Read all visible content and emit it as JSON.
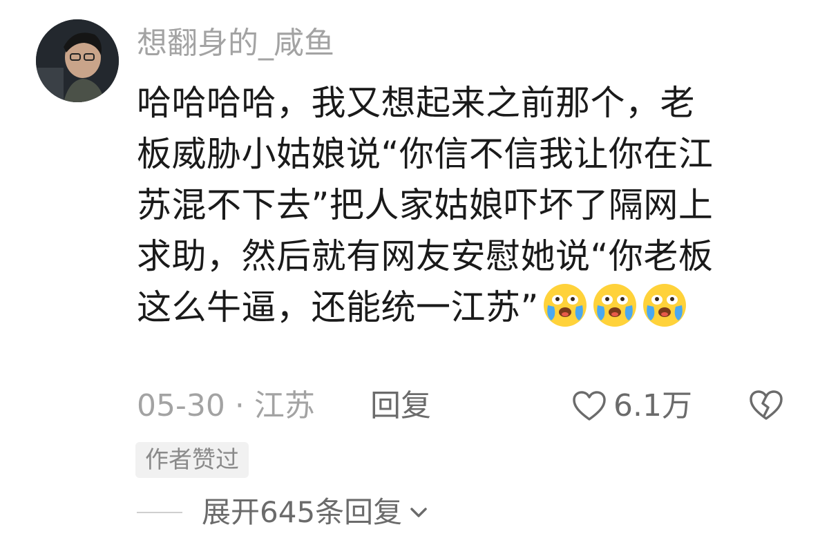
{
  "comment": {
    "username": "想翻身的_咸鱼",
    "content_lines": [
      "哈哈哈哈，我又想起来之前那个，老",
      "板威胁小姑娘说“你信不信我让你在江",
      "苏混不下去”把人家姑娘吓坏了隔网上",
      "求助，然后就有网友安慰她说“你老板",
      "这么牛逼，还能统一江苏”"
    ],
    "emojis": [
      "crying-laugh-emoji",
      "crying-laugh-emoji",
      "crying-laugh-emoji"
    ],
    "date": "05-30",
    "separator": "·",
    "location": "江苏",
    "reply_label": "回复",
    "like_count": "6.1万",
    "author_badge": "作者赞过",
    "expand_label": "展开645条回复"
  },
  "colors": {
    "text_primary": "#1a1a1a",
    "text_secondary": "#a3a3a3",
    "badge_bg": "#f1f1f1",
    "emoji_face": "#ffd23a",
    "emoji_tears": "#4aa8f0"
  }
}
